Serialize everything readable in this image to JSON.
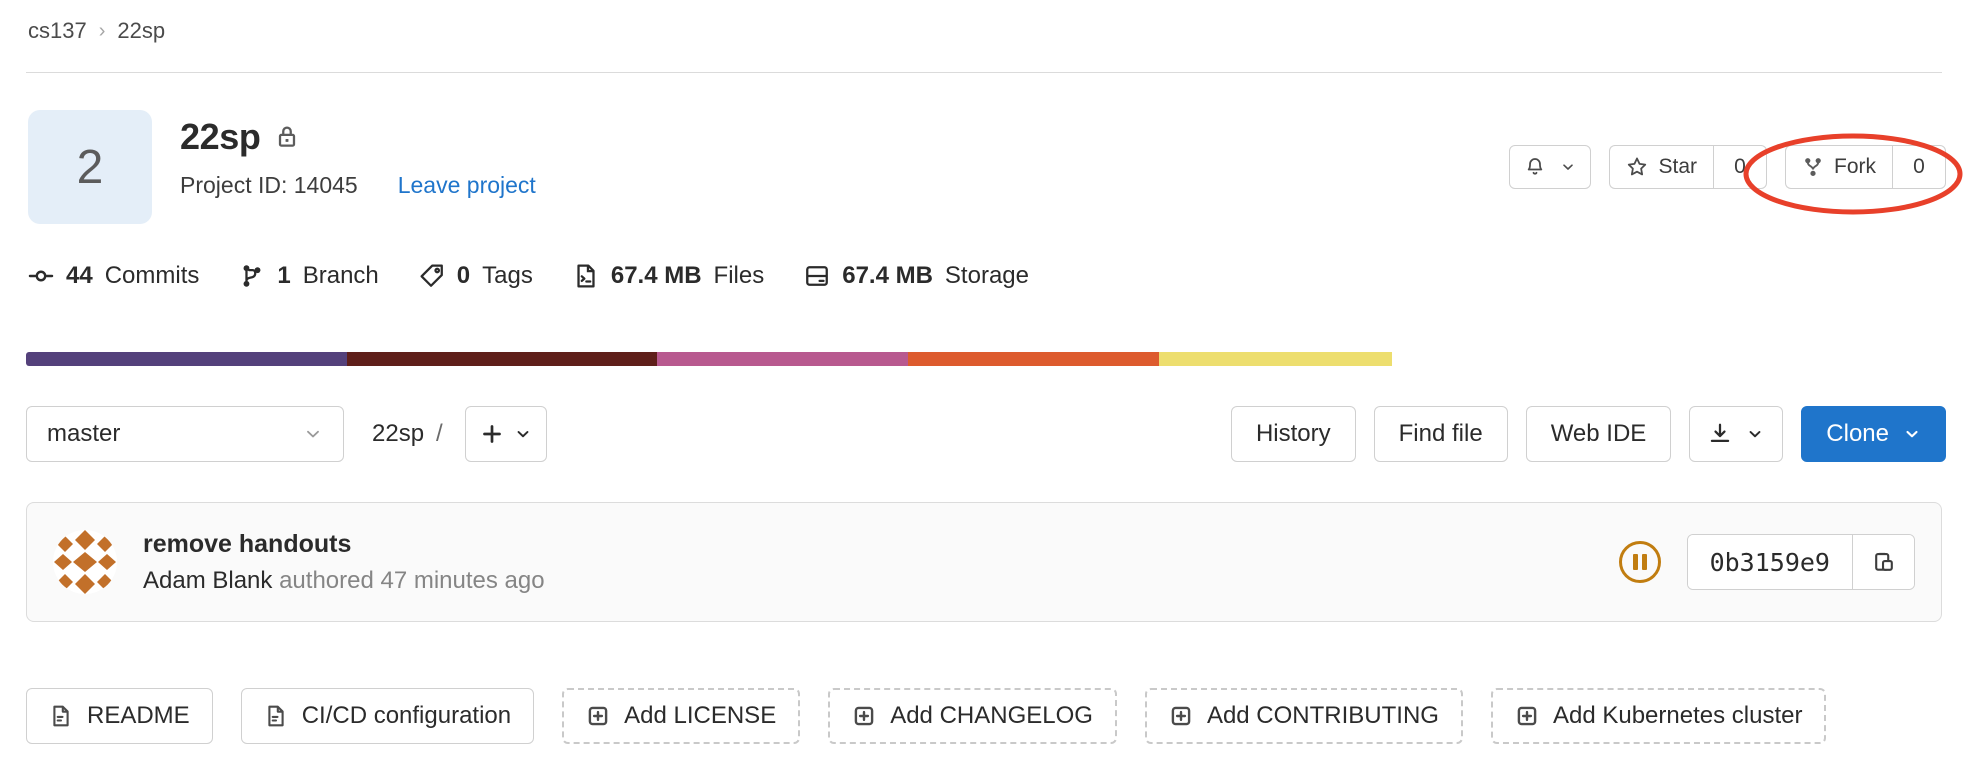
{
  "breadcrumb": {
    "group": "cs137",
    "separator": "›",
    "project": "22sp"
  },
  "project": {
    "avatar_initial": "2",
    "name": "22sp",
    "visibility_icon": "lock-icon",
    "project_id_label": "Project ID: 14045",
    "leave_label": "Leave project"
  },
  "header_actions": {
    "notification_icon": "bell-icon",
    "notification_chevron": "chevron-down-icon",
    "star_icon": "star-icon",
    "star_label": "Star",
    "star_count": "0",
    "fork_icon": "fork-icon",
    "fork_label": "Fork",
    "fork_count": "0"
  },
  "stats": [
    {
      "icon": "commit-icon",
      "value": "44",
      "label": "Commits"
    },
    {
      "icon": "branch-icon",
      "value": "1",
      "label": "Branch"
    },
    {
      "icon": "tag-icon",
      "value": "0",
      "label": "Tags"
    },
    {
      "icon": "files-icon",
      "value": "67.4 MB",
      "label": "Files"
    },
    {
      "icon": "storage-icon",
      "value": "67.4 MB",
      "label": "Storage"
    }
  ],
  "language_bar": [
    {
      "color": "#54417b",
      "width": 18.7
    },
    {
      "color": "#5f1f1a",
      "width": 18.1
    },
    {
      "color": "#b8598f",
      "width": 14.6
    },
    {
      "color": "#dd5b2e",
      "width": 14.6
    },
    {
      "color": "#edde6e",
      "width": 13.6
    }
  ],
  "branch_row": {
    "branch": "master",
    "branch_chevron": "chevron-down-icon",
    "path_root": "22sp",
    "path_separator": "/",
    "add_icon": "plus-icon",
    "add_chevron": "chevron-down-icon",
    "history_label": "History",
    "find_file_label": "Find file",
    "web_ide_label": "Web IDE",
    "download_icon": "download-icon",
    "download_chevron": "chevron-down-icon",
    "clone_label": "Clone",
    "clone_chevron": "chevron-down-icon",
    "clone_color": "#1f75cb"
  },
  "commit": {
    "avatar": "identicon-avatar",
    "title": "remove handouts",
    "author": "Adam Blank",
    "byline_suffix": "authored 47 minutes ago",
    "pipeline_status_icon": "pipeline-pending-icon",
    "pipeline_status_color": "#c17d10",
    "sha": "0b3159e9",
    "copy_icon": "copy-icon"
  },
  "file_buttons": [
    {
      "icon": "file-icon",
      "label": "README",
      "style": "solid"
    },
    {
      "icon": "file-icon",
      "label": "CI/CD configuration",
      "style": "solid"
    },
    {
      "icon": "plus-square-icon",
      "label": "Add LICENSE",
      "style": "dashed"
    },
    {
      "icon": "plus-square-icon",
      "label": "Add CHANGELOG",
      "style": "dashed"
    },
    {
      "icon": "plus-square-icon",
      "label": "Add CONTRIBUTING",
      "style": "dashed"
    },
    {
      "icon": "plus-square-icon",
      "label": "Add Kubernetes cluster",
      "style": "dashed"
    }
  ],
  "annotation": {
    "shape": "ellipse",
    "color": "#e8402a",
    "target": "fork-button"
  }
}
